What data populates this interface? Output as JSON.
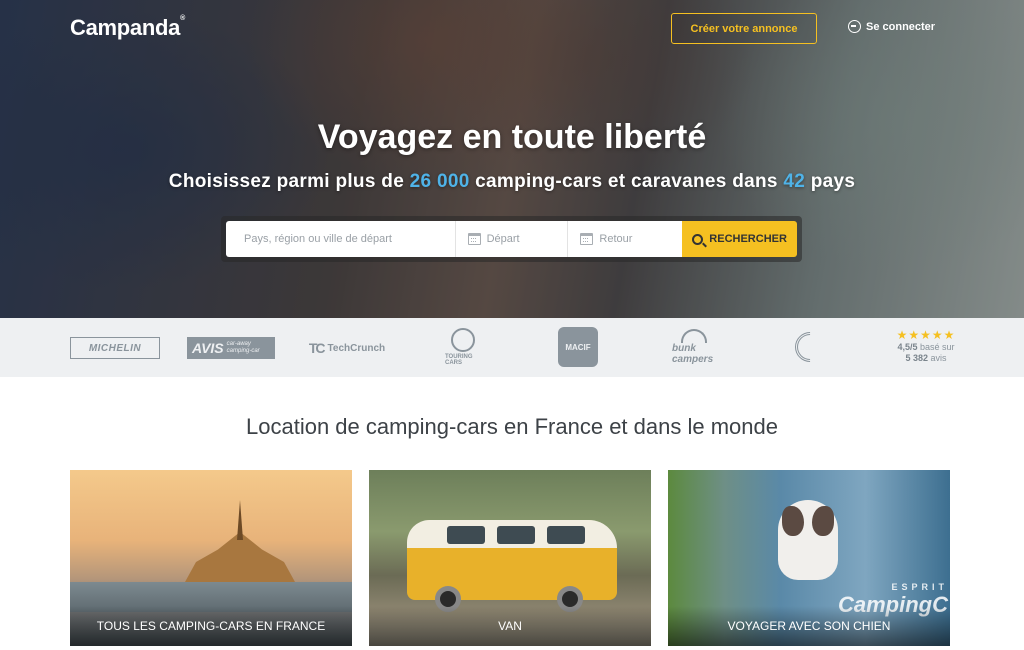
{
  "header": {
    "logo": "Campanda",
    "logo_mark": "®",
    "create_listing": "Créer votre annonce",
    "login": "Se connecter"
  },
  "hero": {
    "title": "Voyagez en toute liberté",
    "subtitle_pre": "Choisissez parmi plus de",
    "subtitle_count": "26 000",
    "subtitle_mid": "camping-cars et caravanes dans",
    "subtitle_countries": "42",
    "subtitle_post": "pays"
  },
  "search": {
    "place_placeholder": "Pays, région ou ville de départ",
    "departure": "Départ",
    "return": "Retour",
    "button": "RECHERCHER"
  },
  "partners": {
    "michelin": "MICHELIN",
    "avis": "AVIS",
    "avis_sub": "car-away camping-car",
    "techcrunch": "TechCrunch",
    "tc_mark": "TC",
    "touring": "TOURING CARS",
    "macif": "MACIF",
    "bunk": "bunk campers"
  },
  "rating": {
    "stars": "★★★★★",
    "score": "4,5/5",
    "score_suffix": "basé sur",
    "count": "5 382",
    "count_suffix": "avis"
  },
  "section": {
    "title": "Location de camping-cars en France et dans le monde"
  },
  "cards": [
    {
      "label": "TOUS LES CAMPING-CARS EN FRANCE"
    },
    {
      "label": "VAN"
    },
    {
      "label": "VOYAGER AVEC SON CHIEN",
      "overlay_small": "ESPRIT",
      "overlay": "CampingC"
    }
  ],
  "colors": {
    "accent": "#f5c021",
    "highlight": "#4fb3e8",
    "strip": "#eef0f2"
  }
}
